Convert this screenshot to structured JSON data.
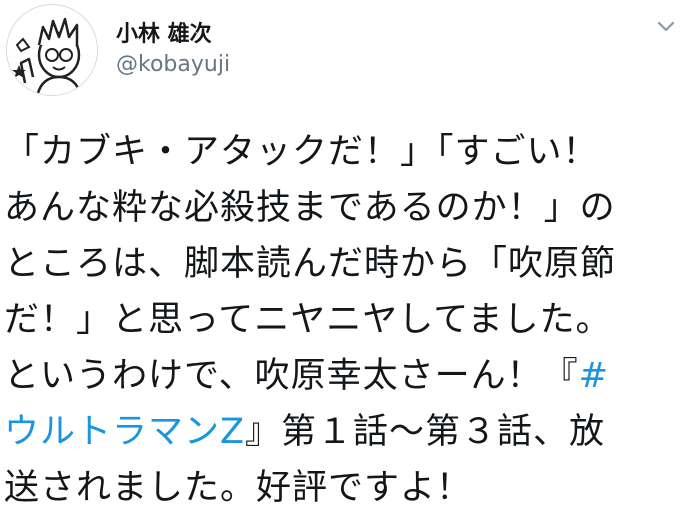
{
  "user": {
    "display_name": "小林 雄次",
    "handle": "@kobayuji"
  },
  "menu": {
    "icon": "chevron-down-icon"
  },
  "tweet": {
    "line_1": "「カブキ・アタックだ！」「すごい！",
    "line_2": "あんな粋な必殺技まであるのか！」の",
    "line_3": "ところは、脚本読んだ時から「吹原節",
    "line_4": "だ！」と思ってニヤニヤしてました。",
    "line_5_prefix": "というわけで、吹原幸太さーん！『",
    "hashtag_part_1": "#",
    "hashtag_part_2": "ウルトラマンZ",
    "line_6_suffix": "』第１話〜第３話、放",
    "line_7": "送されました。好評ですよ！"
  },
  "colors": {
    "text": "#14171a",
    "secondary": "#657786",
    "link": "#1b95e0"
  }
}
